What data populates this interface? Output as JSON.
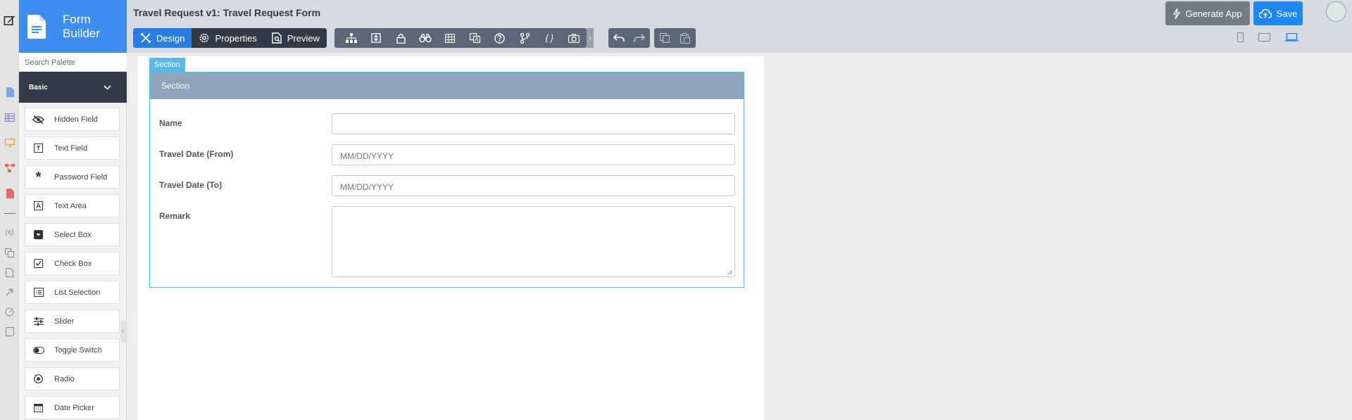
{
  "app": {
    "brand_line1": "Form",
    "brand_line2": "Builder"
  },
  "header": {
    "title": "Travel Request v1: Travel Request Form"
  },
  "modes": [
    {
      "label": "Design",
      "icon": "design-tools-icon",
      "active": true
    },
    {
      "label": "Properties",
      "icon": "gear-icon",
      "active": false
    },
    {
      "label": "Preview",
      "icon": "preview-icon",
      "active": false
    }
  ],
  "toolbar": {
    "icons": [
      "tree-icon",
      "move-icon",
      "lock-icon",
      "binoculars-icon",
      "table-icon",
      "translate-icon",
      "help-icon",
      "branch-icon",
      "braces-icon",
      "camera-icon"
    ],
    "history_icons": [
      "undo-icon",
      "redo-icon"
    ],
    "clipboard_icons": [
      "copy-icon",
      "paste-icon"
    ]
  },
  "actions": {
    "generate_label": "Generate App",
    "save_label": "Save"
  },
  "devices": [
    "mobile-icon",
    "tablet-icon",
    "desktop-icon"
  ],
  "palette": {
    "search_placeholder": "Search Palette",
    "group_label": "Basic",
    "items": [
      {
        "label": "Hidden Field",
        "icon": "eye-slash-icon"
      },
      {
        "label": "Text Field",
        "icon": "text-field-icon"
      },
      {
        "label": "Password Field",
        "icon": "asterisk-icon"
      },
      {
        "label": "Text Area",
        "icon": "text-area-icon"
      },
      {
        "label": "Select Box",
        "icon": "select-box-icon"
      },
      {
        "label": "Check Box",
        "icon": "checkbox-icon"
      },
      {
        "label": "List Selection",
        "icon": "list-icon"
      },
      {
        "label": "Slider",
        "icon": "slider-icon"
      },
      {
        "label": "Toggle Switch",
        "icon": "toggle-icon"
      },
      {
        "label": "Radio",
        "icon": "radio-icon"
      },
      {
        "label": "Date Picker",
        "icon": "calendar-icon"
      }
    ]
  },
  "canvas": {
    "section_tab": "Section",
    "section_title": "Section",
    "fields": [
      {
        "label": "Name",
        "placeholder": ""
      },
      {
        "label": "Travel Date (From)",
        "placeholder": "MM/DD/YYYY"
      },
      {
        "label": "Travel Date (To)",
        "placeholder": "MM/DD/YYYY"
      },
      {
        "label": "Remark",
        "placeholder": ""
      }
    ]
  },
  "colors": {
    "brand": "#3d8ef0",
    "active_mode": "#2a7de1",
    "section_header": "#8ea4b8",
    "selection": "#5ab9e6",
    "save": "#1f86f2"
  }
}
